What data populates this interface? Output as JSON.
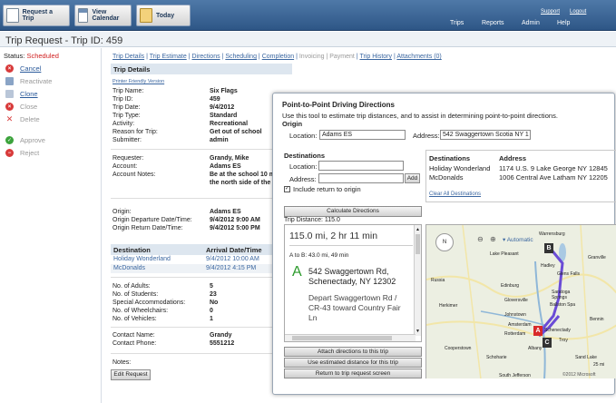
{
  "toolbar": {
    "request_trip": "Request a Trip",
    "view_calendar": "View Calendar",
    "today": "Today"
  },
  "nav": {
    "trips": "Trips",
    "reports": "Reports",
    "admin": "Admin",
    "help": "Help",
    "support": "Support",
    "logout": "Logout"
  },
  "page": {
    "title": "Trip Request - Trip ID: 459"
  },
  "sidebar": {
    "status_label": "Status:",
    "status_value": "Scheduled",
    "cancel": "Cancel",
    "reactivate": "Reactivate",
    "clone": "Clone",
    "close": "Close",
    "delete": "Delete",
    "approve": "Approve",
    "reject": "Reject"
  },
  "tabs": {
    "trip_details": "Trip Details",
    "trip_estimate": "Trip Estimate",
    "directions": "Directions",
    "scheduling": "Scheduling",
    "completion": "Completion",
    "invoicing": "Invoicing",
    "payment": "Payment",
    "trip_history": "Trip History",
    "attachments": "Attachments (0)",
    "sep": "|"
  },
  "details": {
    "header": "Trip Details",
    "printer": "Printer Friendly Version",
    "trip_name_l": "Trip Name:",
    "trip_name": "Six Flags",
    "trip_id_l": "Trip ID:",
    "trip_id": "459",
    "trip_date_l": "Trip Date:",
    "trip_date": "9/4/2012",
    "trip_type_l": "Trip Type:",
    "trip_type": "Standard",
    "activity_l": "Activity:",
    "activity": "Recreational",
    "reason_l": "Reason for Trip:",
    "reason": "Get out of school",
    "submitter_l": "Submitter:",
    "submitter": "admin",
    "requester_l": "Requester:",
    "requester": "Grandy, Mike",
    "account_l": "Account:",
    "account": "Adams ES",
    "notes_l": "Account Notes:",
    "notes_1": "Be at the school 10 m",
    "notes_2": "the north side of the",
    "origin_l": "Origin:",
    "origin": "Adams ES",
    "dep_l": "Origin Departure Date/Time:",
    "dep": "9/4/2012 9:00 AM",
    "ret_l": "Origin Return Date/Time:",
    "ret": "9/4/2012 5:00 PM",
    "dest_col": "Destination",
    "arr_col": "Arrival Date/Time",
    "d1_name": "Holiday Wonderland",
    "d1_time": "9/4/2012 10:00 AM",
    "d2_name": "McDonalds",
    "d2_time": "9/4/2012 4:15 PM",
    "adults_l": "No. of Adults:",
    "adults": "5",
    "students_l": "No. of Students:",
    "students": "23",
    "special_l": "Special Accommodations:",
    "special": "No",
    "wheel_l": "No. of Wheelchairs:",
    "wheel": "0",
    "vehicles_l": "No. of Vehicles:",
    "vehicles": "1",
    "contact_l": "Contact Name:",
    "contact": "Grandy",
    "phone_l": "Contact Phone:",
    "phone": "5551212",
    "notes2_l": "Notes:",
    "edit": "Edit Request"
  },
  "modal": {
    "title": "Point-to-Point Driving Directions",
    "desc": "Use this tool to estimate trip distances, and to assist in determining point-to-point directions.",
    "origin_h": "Origin",
    "location_l": "Location:",
    "location": "Adams ES",
    "address_l": "Address:",
    "address": "542 Swaggertown Scotia NY 1",
    "dest_h": "Destinations",
    "dloc_l": "Location:",
    "daddr_l": "Address:",
    "add": "Add",
    "include": "Include return to origin",
    "col_dest": "Destinations",
    "col_addr": "Address",
    "r1_name": "Holiday Wonderland",
    "r1_addr": "1174 U.S. 9 Lake George NY 12845",
    "r2_name": "McDonalds",
    "r2_addr": "1006 Central Ave Latham NY 12205",
    "clear": "Clear All Destinations",
    "calc": "Calculate Directions",
    "distance": "Trip Distance: 115.0",
    "summary": "115.0 mi, 2 hr 11 min",
    "leg": "A to B: 43.0 mi, 49 min",
    "marker": "A",
    "addr1": "542 Swaggertown Rd,",
    "addr2": "Schenectady, NY 12302",
    "step1": "Depart Swaggertown Rd /",
    "step2": "CR-43 toward Country Fair",
    "step3": "Ln",
    "attach": "Attach directions to this trip",
    "use": "Use estimated distance for this trip",
    "ret_btn": "Return to trip request screen"
  },
  "map": {
    "automatic": "Automatic",
    "nav": "N",
    "places": [
      "Warrensburg",
      "Lake Pleasant",
      "Hadley",
      "Glens Falls",
      "Granville",
      "Russia",
      "Edinburg",
      "Saratoga",
      "Springs",
      "Gloversville",
      "Ballston Spa",
      "Herkimer",
      "Johnstown",
      "Amsterdam",
      "Schenectady",
      "Troy",
      "Bennin",
      "Rotterdam",
      "Albany",
      "Cooperstown",
      "Schoharie",
      "South Jefferson",
      "Sand Lake"
    ],
    "m_a": "A",
    "m_b": "B",
    "m_c": "C",
    "scale": "25 mi",
    "copyright": "©2012 Microsoft"
  }
}
